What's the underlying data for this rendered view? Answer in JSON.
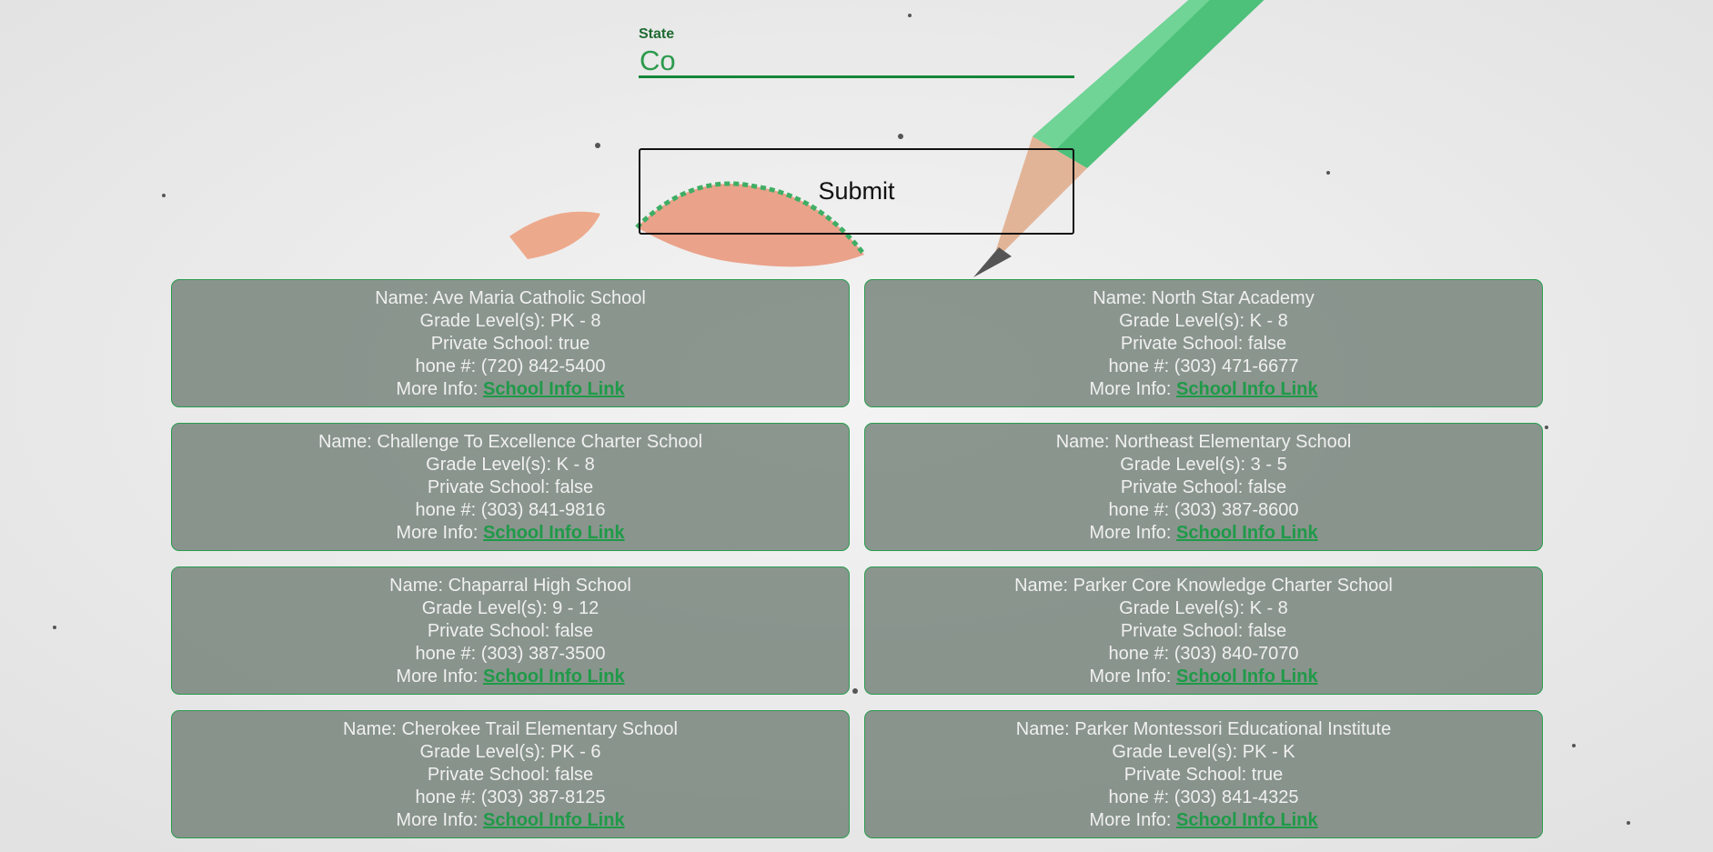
{
  "form": {
    "state_label": "State",
    "state_value": "Co",
    "submit_label": "Submit"
  },
  "labels": {
    "name": "Name: ",
    "grade": "Grade Level(s): ",
    "private": "Private School: ",
    "phone": "hone #: ",
    "more_info": "More Info: "
  },
  "schools": [
    {
      "name": "Ave Maria Catholic School",
      "grades": "PK - 8",
      "private": "true",
      "phone": "(720) 842-5400",
      "link_text": "School Info Link"
    },
    {
      "name": "North Star Academy",
      "grades": "K - 8",
      "private": "false",
      "phone": "(303) 471-6677",
      "link_text": "School Info Link"
    },
    {
      "name": "Challenge To Excellence Charter School",
      "grades": "K - 8",
      "private": "false",
      "phone": "(303) 841-9816",
      "link_text": "School Info Link"
    },
    {
      "name": "Northeast Elementary School",
      "grades": "3 - 5",
      "private": "false",
      "phone": "(303) 387-8600",
      "link_text": "School Info Link"
    },
    {
      "name": "Chaparral High School",
      "grades": "9 - 12",
      "private": "false",
      "phone": "(303) 387-3500",
      "link_text": "School Info Link"
    },
    {
      "name": "Parker Core Knowledge Charter School",
      "grades": "K - 8",
      "private": "false",
      "phone": "(303) 840-7070",
      "link_text": "School Info Link"
    },
    {
      "name": "Cherokee Trail Elementary School",
      "grades": "PK - 6",
      "private": "false",
      "phone": "(303) 387-8125",
      "link_text": "School Info Link"
    },
    {
      "name": "Parker Montessori Educational Institute",
      "grades": "PK - K",
      "private": "true",
      "phone": "(303) 841-4325",
      "link_text": "School Info Link"
    }
  ],
  "colors": {
    "accent_green": "#14873a",
    "label_green": "#1f6b32",
    "card_fill": "#707e76"
  }
}
